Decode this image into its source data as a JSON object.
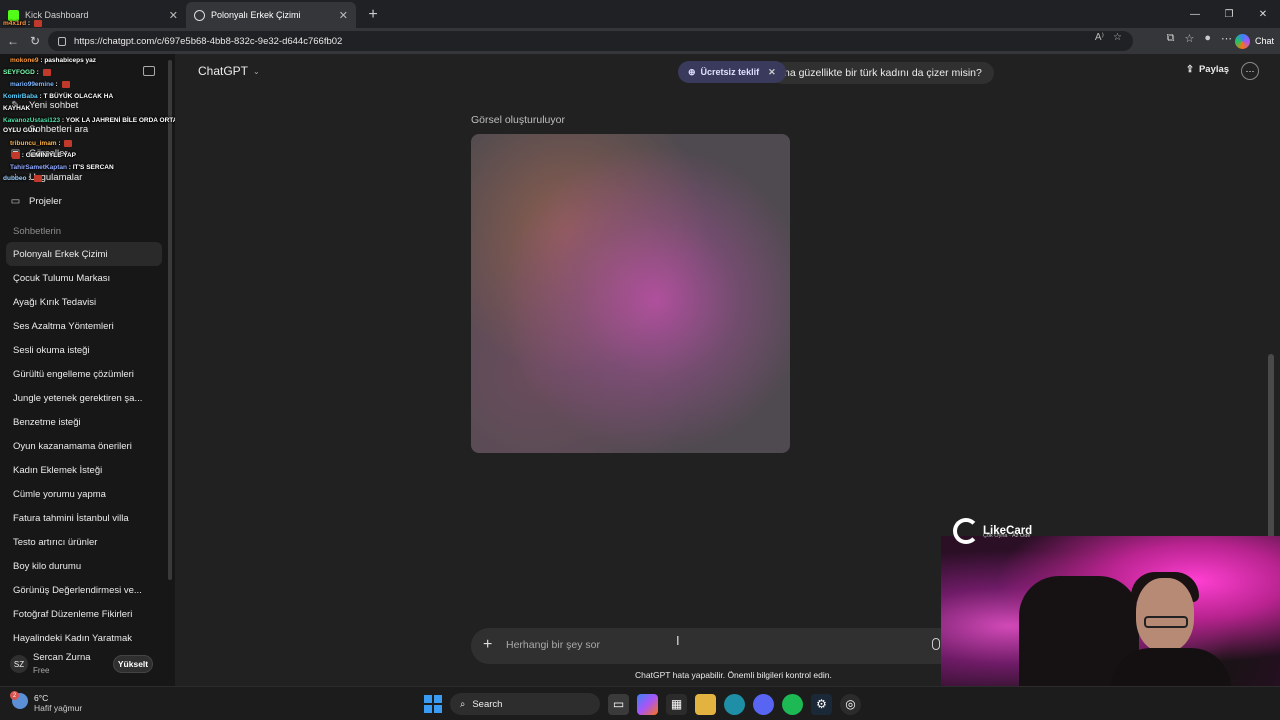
{
  "browser": {
    "tabs": [
      {
        "label": "Kick Dashboard",
        "active": false,
        "icon": "kick-icon"
      },
      {
        "label": "Polonyalı Erkek Çizimi",
        "active": true,
        "icon": "chatgpt-icon"
      }
    ],
    "url": "https://chatgpt.com/c/697e5b68-4bb8-832c-9e32-d644c766fb02",
    "chat_button": "Chat"
  },
  "sidebar": {
    "nav": [
      {
        "label": "Yeni sohbet",
        "icon": "edit-icon"
      },
      {
        "label": "Sohbetleri ara",
        "icon": "search-icon"
      },
      {
        "label": "Görseller",
        "icon": "image-icon"
      },
      {
        "label": "Uygulamalar",
        "icon": "apps-icon"
      },
      {
        "label": "Projeler",
        "icon": "folder-icon"
      }
    ],
    "section_title": "Sohbetlerin",
    "chats": [
      "Polonyalı Erkek Çizimi",
      "Çocuk Tulumu Markası",
      "Ayağı Kırık Tedavisi",
      "Ses Azaltma Yöntemleri",
      "Sesli okuma isteği",
      "Gürültü engelleme çözümleri",
      "Jungle yetenek gerektiren şa...",
      "Benzetme isteği",
      "Oyun kazanamama önerileri",
      "Kadın Eklemek İsteği",
      "Cümle yorumu yapma",
      "Fatura tahmini İstanbul villa",
      "Testo artırıcı ürünler",
      "Boy kilo durumu",
      "Görünüş Değerlendirmesi ve...",
      "Fotoğraf Düzenleme Fikirleri",
      "Hayalindeki Kadın Yaratmak"
    ],
    "user": {
      "initials": "SZ",
      "name": "Sercan Zurna",
      "plan": "Free",
      "upgrade": "Yükselt"
    }
  },
  "stream_chat": [
    {
      "name": "m4x1rd",
      "text": ""
    },
    {
      "name": "mokone9",
      "text": "pashabiceps yaz"
    },
    {
      "name": "SEYFOGD",
      "text": ""
    },
    {
      "name": "mario99emine",
      "text": ""
    },
    {
      "name": "KomirBaba",
      "text": "T BÜYÜK OLACAK HA"
    },
    {
      "name": "KAYHAK",
      "text": ""
    },
    {
      "name": "KavanozUstasi123",
      "text": "YOK LA JAHRENİ BİLE ORDA ORTALAMA SINIRI"
    },
    {
      "name": "OYLU GUN",
      "text": ""
    },
    {
      "name": "tribuncu_imam",
      "text": ""
    },
    {
      "name": "",
      "text": "GEMİNİYLE YAP"
    },
    {
      "name": "TahirSametKaptan",
      "text": "IT'S SERCAN"
    },
    {
      "name": "dubbeo",
      "text": ""
    }
  ],
  "header": {
    "model": "ChatGPT",
    "promo": "Ücretsiz teklif",
    "share": "Paylaş"
  },
  "conversation": {
    "user_message": "na güzellikte bir türk kadını da çizer misin?",
    "status": "Görsel oluşturuluyor"
  },
  "composer": {
    "placeholder": "Herhangi bir şey sor",
    "disclaimer": "ChatGPT hata yapabilir. Önemli bilgileri kontrol edin."
  },
  "overlay": {
    "brand": "LikeCard",
    "brand_sub": "Çok Oyna · Az Öde"
  },
  "taskbar": {
    "temperature": "6°C",
    "weather": "Hafif yağmur",
    "weather_badge": "2",
    "search": "Search"
  }
}
